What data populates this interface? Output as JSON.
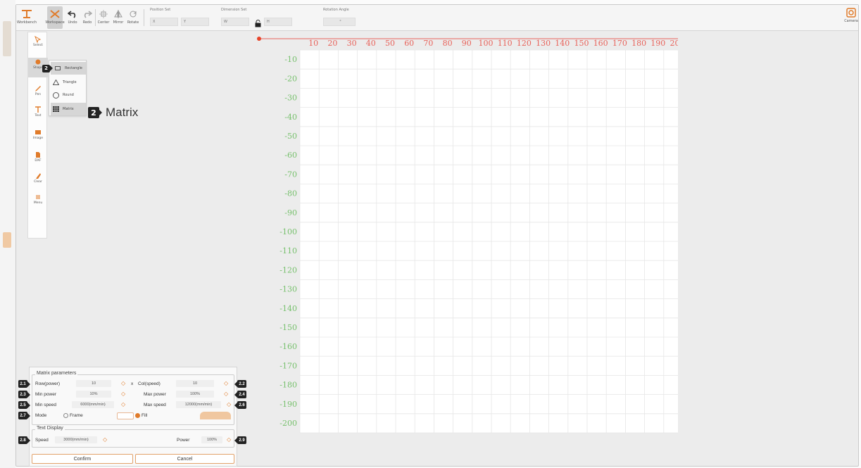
{
  "toolbar": {
    "buttons": [
      {
        "label": "Workbench"
      },
      {
        "label": "Workspace"
      },
      {
        "label": "Undo"
      },
      {
        "label": "Redo"
      },
      {
        "label": "Center"
      },
      {
        "label": "Mirror"
      },
      {
        "label": "Rotate"
      }
    ],
    "position_label": "Position Set",
    "position_x": "X",
    "position_y": "Y",
    "dimension_label": "Dimension Set",
    "dimension_w": "W",
    "dimension_h": "H",
    "rotation_label": "Rotation Angle",
    "rotation_value": "°",
    "camera_label": "Camera"
  },
  "sidetools": [
    {
      "label": "Select",
      "icon": "select-icon"
    },
    {
      "label": "Shape",
      "icon": "shape-icon"
    },
    {
      "label": "Pen",
      "icon": "pen-icon"
    },
    {
      "label": "Text",
      "icon": "text-icon"
    },
    {
      "label": "Image",
      "icon": "image-icon"
    },
    {
      "label": "DXF",
      "icon": "dxf-icon"
    },
    {
      "label": "Clear",
      "icon": "clear-icon"
    },
    {
      "label": "Menu",
      "icon": "menu-icon"
    }
  ],
  "flyout": {
    "badge": "2",
    "items": [
      {
        "label": "Rectangle"
      },
      {
        "label": "Triangle"
      },
      {
        "label": "Round"
      },
      {
        "label": "Matrix"
      }
    ]
  },
  "callout": {
    "badge": "2",
    "text": "Matrix"
  },
  "ruler": {
    "x_ticks": [
      "10",
      "20",
      "30",
      "40",
      "50",
      "60",
      "70",
      "80",
      "90",
      "100",
      "110",
      "120",
      "130",
      "140",
      "150",
      "160",
      "170",
      "180",
      "190",
      "200"
    ],
    "y_ticks": [
      "-10",
      "-20",
      "-30",
      "-40",
      "-50",
      "-60",
      "-70",
      "-80",
      "-90",
      "-100",
      "-110",
      "-120",
      "-130",
      "-140",
      "-150",
      "-160",
      "-170",
      "-180",
      "-190",
      "-200"
    ],
    "x_color": "#e8625a",
    "y_color": "#76c06c"
  },
  "matrix": {
    "title": "Matrix parameters",
    "row_label": "Row(power)",
    "row_value": "10",
    "row_badge": "2.1",
    "times": "x",
    "col_label": "Col(speed)",
    "col_value": "10",
    "col_badge": "2.2",
    "minpower_label": "Min power",
    "minpower_value": "10%",
    "minpower_badge": "2.3",
    "maxpower_label": "Max power",
    "maxpower_value": "100%",
    "maxpower_badge": "2.4",
    "minspeed_label": "Min speed",
    "minspeed_value": "6000(mm/min)",
    "minspeed_badge": "2.5",
    "maxspeed_label": "Max speed",
    "maxspeed_value": "12000(mm/min)",
    "maxspeed_badge": "2.6",
    "mode_label": "Mode",
    "mode_badge": "2.7",
    "mode_frame": "Frame",
    "mode_fill": "Fill"
  },
  "text_display": {
    "title": "Text Display",
    "speed_label": "Speed",
    "speed_value": "3000(mm/min)",
    "speed_badge": "2.8",
    "power_label": "Power",
    "power_value": "100%",
    "power_badge": "2.9"
  },
  "buttons": {
    "confirm": "Confirm",
    "cancel": "Cancel"
  },
  "colors": {
    "accent": "#e07b2a",
    "origin": "#e8442a"
  }
}
